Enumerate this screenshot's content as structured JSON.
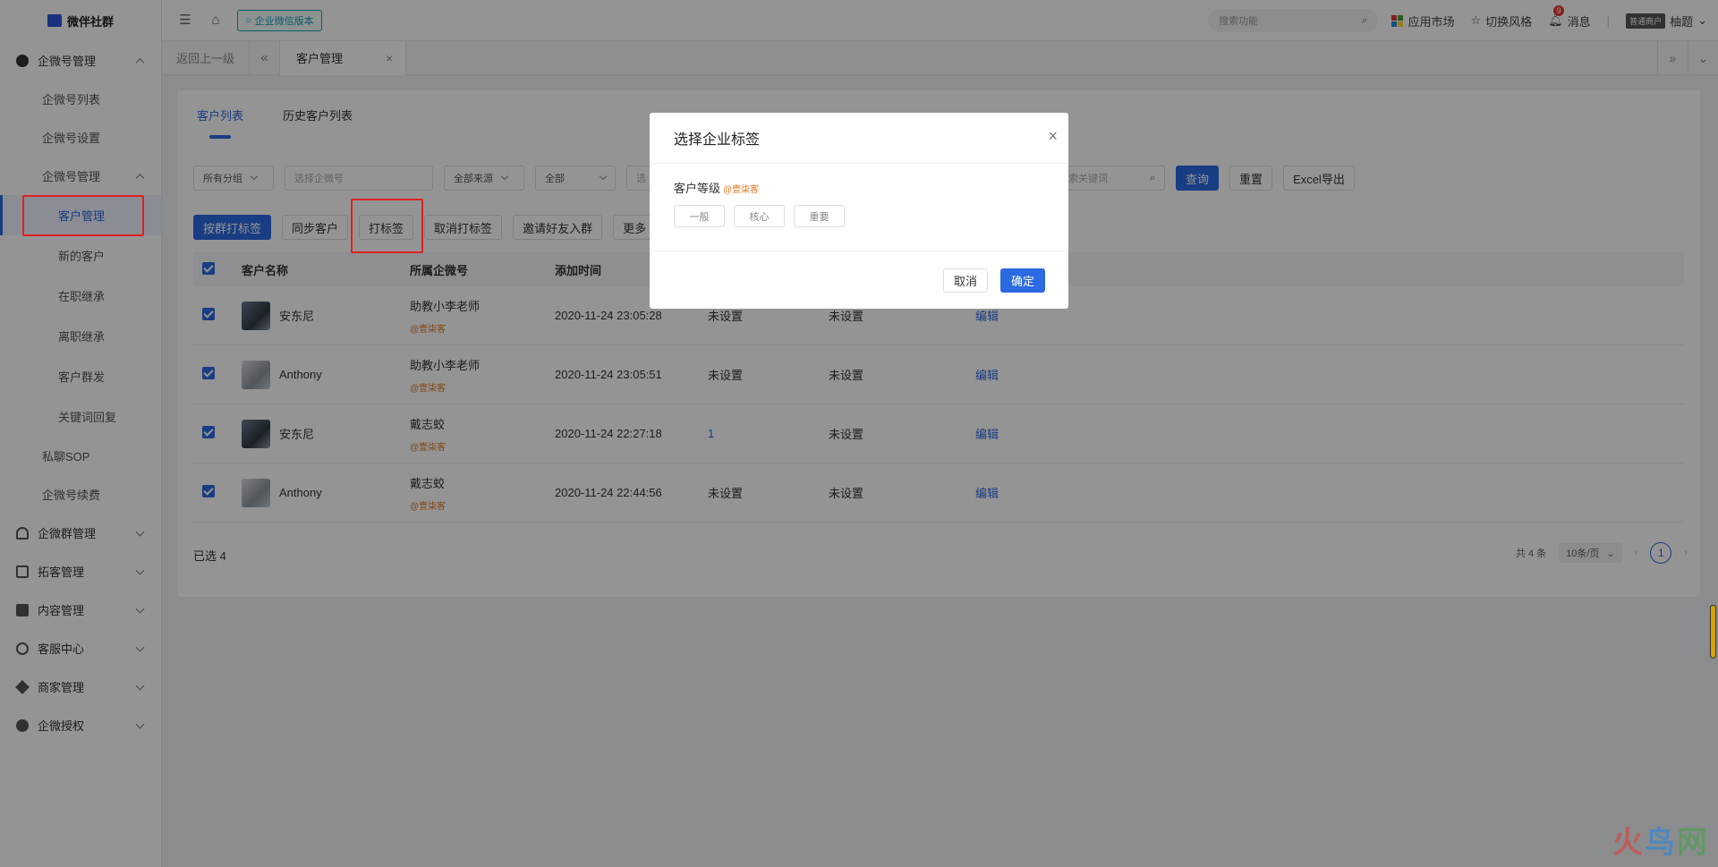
{
  "logo": {
    "text": "微伴社群"
  },
  "topbar": {
    "enterprise_btn": "企业微信版本",
    "search_placeholder": "搜索功能",
    "app_market": "应用市场",
    "switch_style": "切换风格",
    "messages": "消息",
    "message_count": "9",
    "vip_badge": "普通商户",
    "user": "柚题"
  },
  "tabs": {
    "back": "返回上一级",
    "current": "客户管理"
  },
  "sidebar": {
    "group1": "企微号管理",
    "items": [
      "企微号列表",
      "企微号设置",
      "企微号管理"
    ],
    "sub_items": [
      "客户管理",
      "新的客户",
      "在职继承",
      "离职继承",
      "客户群发",
      "关键词回复"
    ],
    "items2": [
      "私聊SOP",
      "企微号续费"
    ],
    "groups": [
      "企微群管理",
      "拓客管理",
      "内容管理",
      "客服中心",
      "商家管理",
      "企微授权"
    ]
  },
  "page": {
    "subtabs": [
      "客户列表",
      "历史客户列表"
    ],
    "filters": {
      "group": "所有分组",
      "account_placeholder": "选择企微号",
      "source": "全部来源",
      "all": "全部",
      "partial": "选",
      "keyword_placeholder": "搜索关键词",
      "query": "查询",
      "reset": "重置",
      "export": "Excel导出"
    },
    "actions": [
      "按群打标签",
      "同步客户",
      "打标签",
      "取消打标签",
      "邀请好友入群",
      "更多"
    ],
    "table": {
      "headers": [
        "客户名称",
        "所属企微号",
        "添加时间"
      ],
      "rows": [
        {
          "name": "安东尼",
          "account": "助教小李老师",
          "tag": "@壹柒客",
          "time": "2020-11-24 23:05:28",
          "a": "未设置",
          "b": "未设置",
          "op": "编辑"
        },
        {
          "name": "Anthony",
          "account": "助教小李老师",
          "tag": "@壹柒客",
          "time": "2020-11-24 23:05:51",
          "a": "未设置",
          "b": "未设置",
          "op": "编辑"
        },
        {
          "name": "安东尼",
          "account": "戴志蛟",
          "tag": "@壹柒客",
          "time": "2020-11-24 22:27:18",
          "a": "1",
          "b": "未设置",
          "op": "编辑"
        },
        {
          "name": "Anthony",
          "account": "戴志蛟",
          "tag": "@壹柒客",
          "time": "2020-11-24 22:44:56",
          "a": "未设置",
          "b": "未设置",
          "op": "编辑"
        }
      ]
    },
    "selected_label": "已选 4",
    "pager": {
      "total": "共 4 条",
      "per_page": "10条/页",
      "current": "1"
    }
  },
  "modal": {
    "title": "选择企业标签",
    "label": "客户等级",
    "label_source": "@壹柒客",
    "tags": [
      "一般",
      "核心",
      "重要"
    ],
    "cancel": "取消",
    "confirm": "确定"
  },
  "watermark": [
    "火",
    "鸟",
    "网"
  ],
  "colors": {
    "primary": "#2b6ae0",
    "highlight": "#e02020",
    "tag_orange": "#e07a20"
  }
}
